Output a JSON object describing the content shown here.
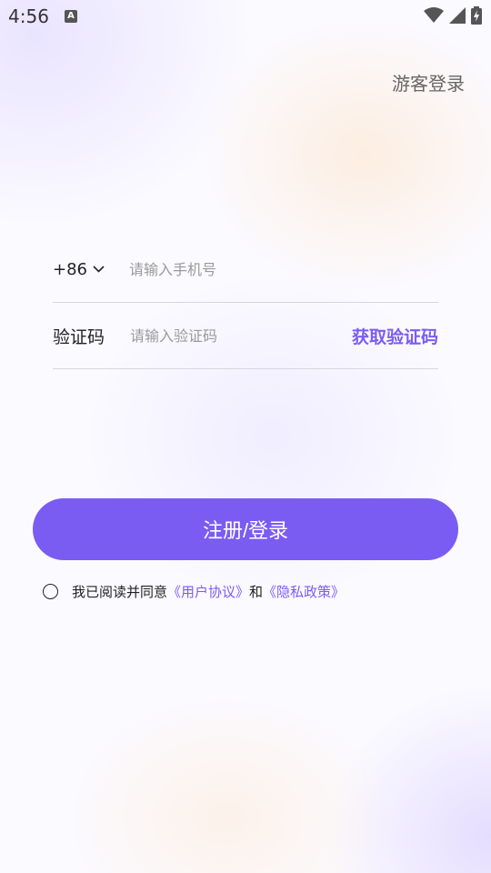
{
  "status_bar": {
    "time": "4:56",
    "notification_icon_letter": "A",
    "icons": [
      "wifi-icon",
      "signal-icon",
      "battery-charging-icon"
    ]
  },
  "header": {
    "guest_login": "游客登录"
  },
  "phone_row": {
    "country_code": "+86",
    "placeholder": "请输入手机号"
  },
  "code_row": {
    "label": "验证码",
    "placeholder": "请输入验证码",
    "get_code": "获取验证码"
  },
  "submit": {
    "label": "注册/登录"
  },
  "agreement": {
    "prefix": "我已阅读并同意",
    "user_agreement": "《用户协议》",
    "conjunction": "和",
    "privacy_policy": "《隐私政策》"
  },
  "colors": {
    "accent": "#7b5cf2",
    "link": "#7c5cf0"
  }
}
